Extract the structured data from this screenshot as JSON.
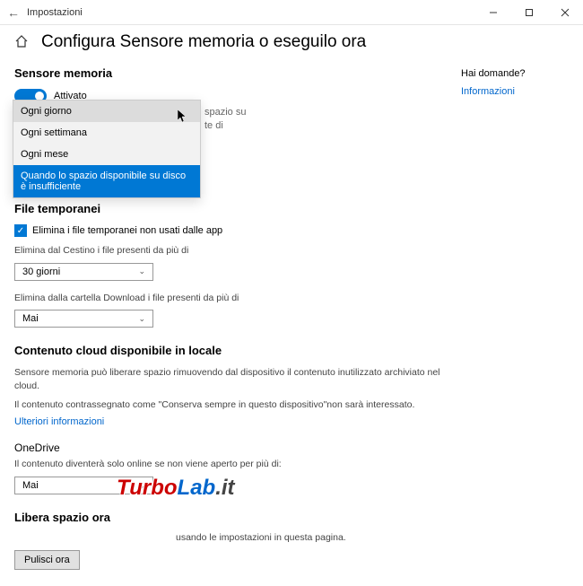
{
  "titlebar": {
    "title": "Impostazioni"
  },
  "header": {
    "page_title": "Configura Sensore memoria o eseguilo ora"
  },
  "sidebar": {
    "heading": "Hai domande?",
    "link": "Informazioni"
  },
  "storage_sense": {
    "heading": "Sensore memoria",
    "toggle_label": "Attivato",
    "behind_text_line1": "spazio su",
    "behind_text_line2": "te di"
  },
  "dropdown_options": {
    "items": [
      {
        "label": "Ogni giorno"
      },
      {
        "label": "Ogni settimana"
      },
      {
        "label": "Ogni mese"
      },
      {
        "label": "Quando lo spazio disponibile su disco è insufficiente"
      }
    ]
  },
  "temp_files": {
    "heading": "File temporanei",
    "checkbox_label": "Elimina i file temporanei non usati dalle app",
    "recycle_label": "Elimina dal Cestino i file presenti da più di",
    "recycle_value": "30 giorni",
    "download_label": "Elimina dalla cartella Download i file presenti da più di",
    "download_value": "Mai"
  },
  "cloud_content": {
    "heading": "Contenuto cloud disponibile in locale",
    "desc1": "Sensore memoria può liberare spazio rimuovendo dal dispositivo il contenuto inutilizzato archiviato nel cloud.",
    "desc2": "Il contenuto contrassegnato come \"Conserva sempre in questo dispositivo\"non sarà interessato.",
    "link": "Ulteriori informazioni",
    "onedrive_heading": "OneDrive",
    "onedrive_desc": "Il contenuto diventerà solo online se non viene aperto per più di:",
    "onedrive_value": "Mai"
  },
  "free_now": {
    "heading": "Libera spazio ora",
    "desc": "usando le impostazioni in questa pagina.",
    "button": "Pulisci ora"
  },
  "watermark": {
    "t1": "Turbo",
    "t2": "Lab",
    "t3": ".it"
  }
}
